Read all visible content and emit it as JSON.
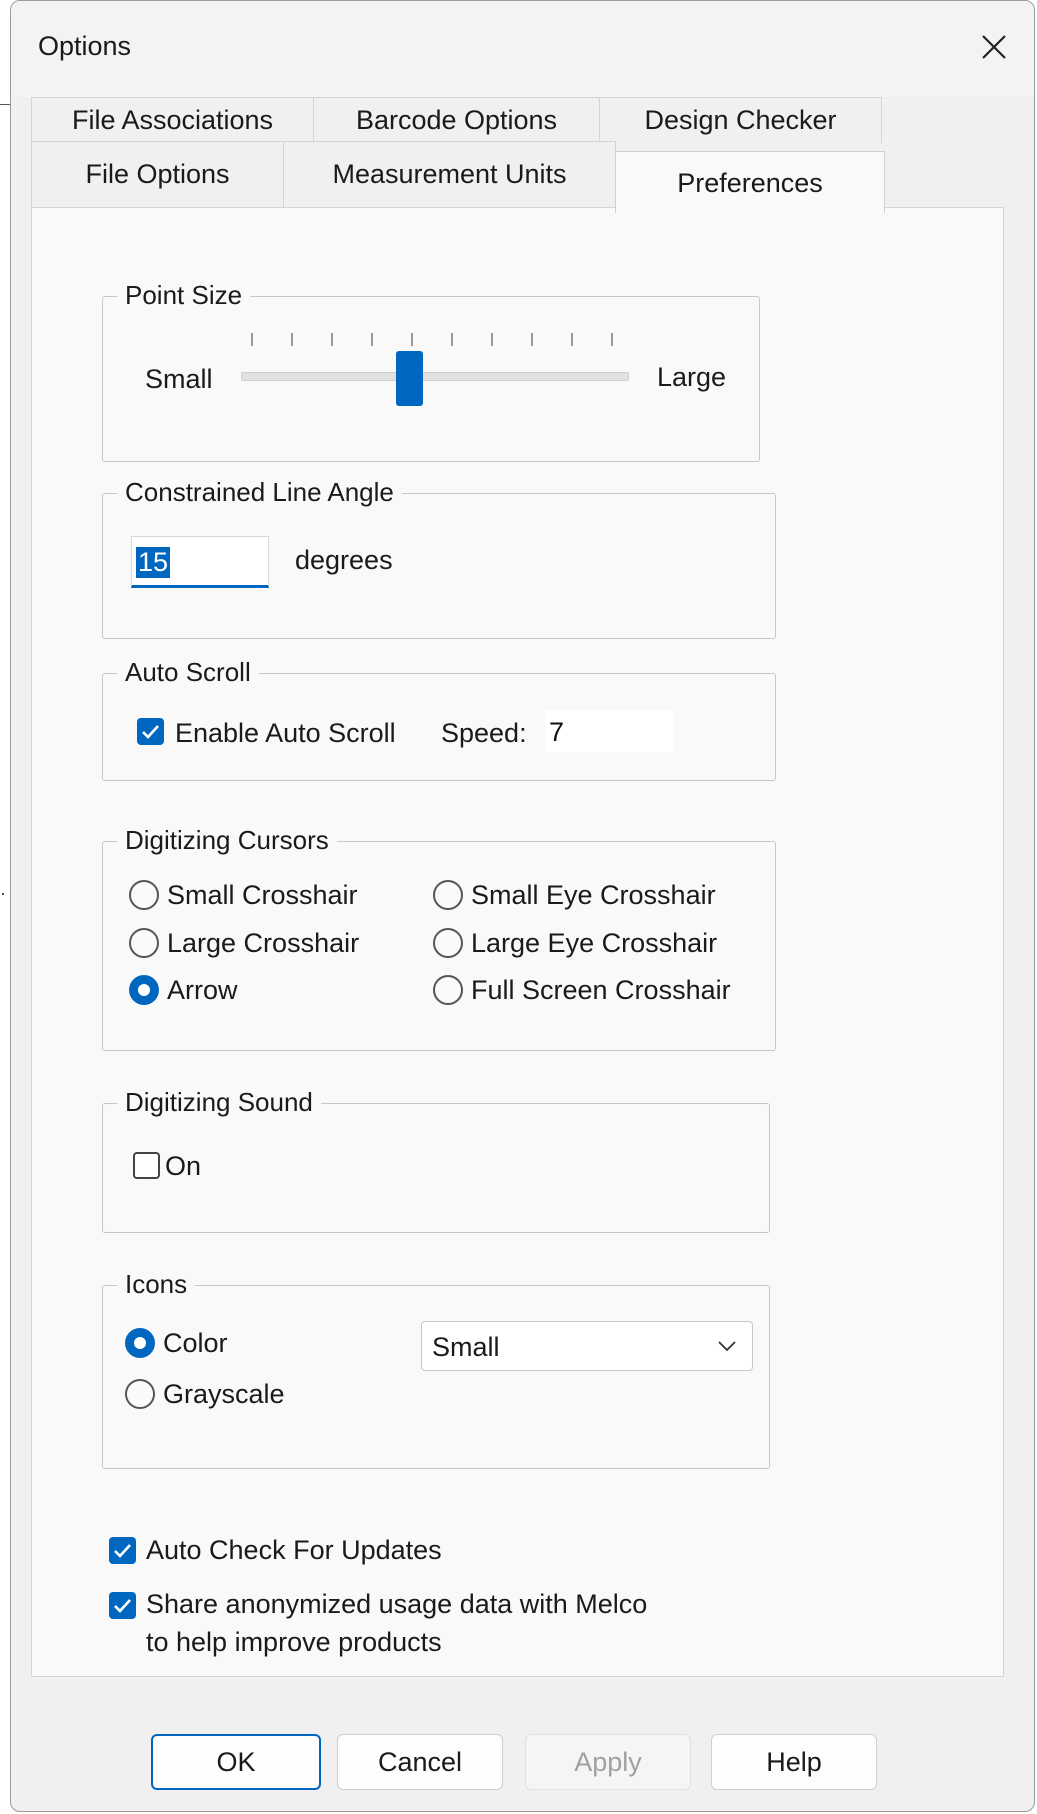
{
  "window": {
    "title": "Options"
  },
  "tabs": {
    "row1": [
      "File Associations",
      "Barcode Options",
      "Design Checker"
    ],
    "row2": [
      "File Options",
      "Measurement Units",
      "Preferences"
    ],
    "active": "Preferences"
  },
  "point_size": {
    "group_label": "Point Size",
    "min_label": "Small",
    "max_label": "Large",
    "tick_count": 10,
    "value_fraction": 0.44
  },
  "line_angle": {
    "group_label": "Constrained Line Angle",
    "value": "15",
    "unit_label": "degrees"
  },
  "auto_scroll": {
    "group_label": "Auto Scroll",
    "enable_label": "Enable Auto Scroll",
    "enabled": true,
    "speed_label": "Speed:",
    "speed_value": "7"
  },
  "cursors": {
    "group_label": "Digitizing Cursors",
    "options": [
      "Small Crosshair",
      "Large Crosshair",
      "Arrow",
      "Small Eye Crosshair",
      "Large Eye Crosshair",
      "Full Screen Crosshair"
    ],
    "selected": "Arrow"
  },
  "sound": {
    "group_label": "Digitizing Sound",
    "on_label": "On",
    "on": false
  },
  "icons": {
    "group_label": "Icons",
    "color_label": "Color",
    "grayscale_label": "Grayscale",
    "selected": "Color",
    "size_value": "Small"
  },
  "updates": {
    "auto_check_label": "Auto Check For Updates",
    "auto_check": true,
    "share_line1": "Share anonymized usage data with Melco",
    "share_line2": "to help improve products",
    "share": true
  },
  "buttons": {
    "ok": "OK",
    "cancel": "Cancel",
    "apply": "Apply",
    "help": "Help"
  },
  "colors": {
    "accent": "#0067c0",
    "dialog_bg": "#f0f0f0",
    "panel_bg": "#f9f9f9"
  }
}
